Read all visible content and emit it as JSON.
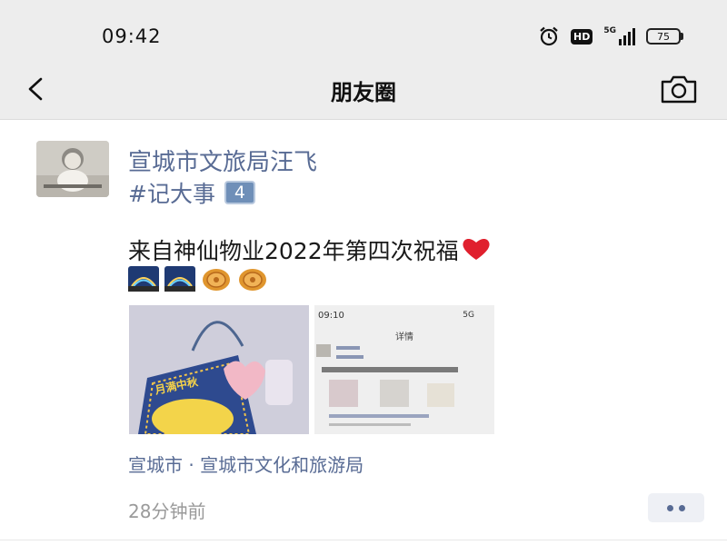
{
  "status_bar": {
    "time": "09:42",
    "hd_label": "HD",
    "network_label": "5G",
    "battery_level": "75"
  },
  "nav": {
    "title": "朋友圈",
    "back_icon": "chevron-left-icon",
    "camera_icon": "camera-icon"
  },
  "post": {
    "author": "宣城市文旅局汪飞",
    "tag": "#记大事",
    "tag_badge": "4",
    "text": "来自神仙物业2022年第四次祝福",
    "text_emoji": "red-heart-icon",
    "emojis": [
      "night-sky-icon",
      "night-sky-icon",
      "mooncake-icon",
      "mooncake-icon"
    ],
    "images": [
      {
        "name": "mooncake-gift-bag-photo",
        "caption": "月满中秋"
      },
      {
        "name": "moments-screenshot-photo",
        "status_time": "09:10",
        "header": "详情",
        "signal": "5G"
      }
    ],
    "location": "宣城市 · 宣城市文化和旅游局",
    "time_ago": "28分钟前"
  },
  "colors": {
    "link": "#586b94",
    "nav_bg": "#ededed",
    "muted": "#9a9a9a"
  }
}
